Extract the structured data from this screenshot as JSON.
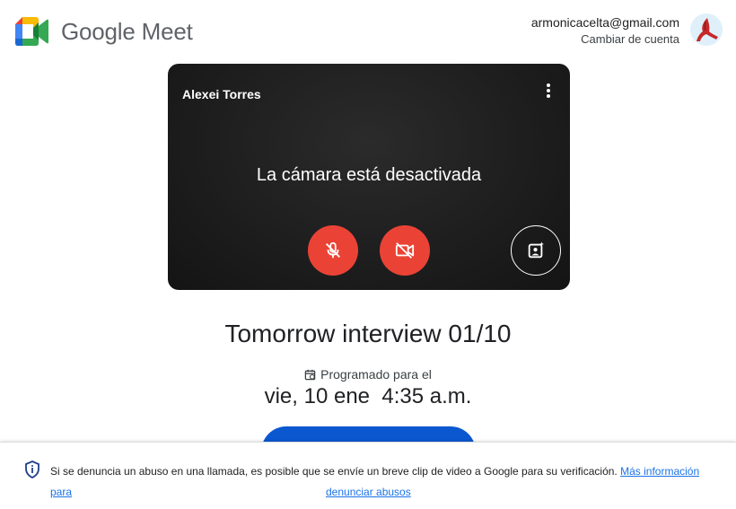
{
  "header": {
    "brand": "Google Meet",
    "account_email": "armonicacelta@gmail.com",
    "switch_account": "Cambiar de cuenta"
  },
  "preview": {
    "participant_name": "Alexei Torres",
    "camera_status": "La cámara está desactivada",
    "mic_state": "off",
    "camera_state": "off",
    "colors": {
      "control_red": "#ea4335",
      "background": "#1e1e1f"
    }
  },
  "meeting": {
    "title": "Tomorrow interview 01/10",
    "scheduled_label": "Programado para el",
    "scheduled_date": "vie, 10 ene  4:35 a.m.",
    "join_button_color": "#0b57d0"
  },
  "notice": {
    "text": "Si se denuncia un abuso en una llamada, es posible que se envíe un breve clip de video a Google para su verificación.",
    "link_part1": "Más información para",
    "link_part2": "denunciar abusos",
    "link_color": "#1a73e8"
  }
}
